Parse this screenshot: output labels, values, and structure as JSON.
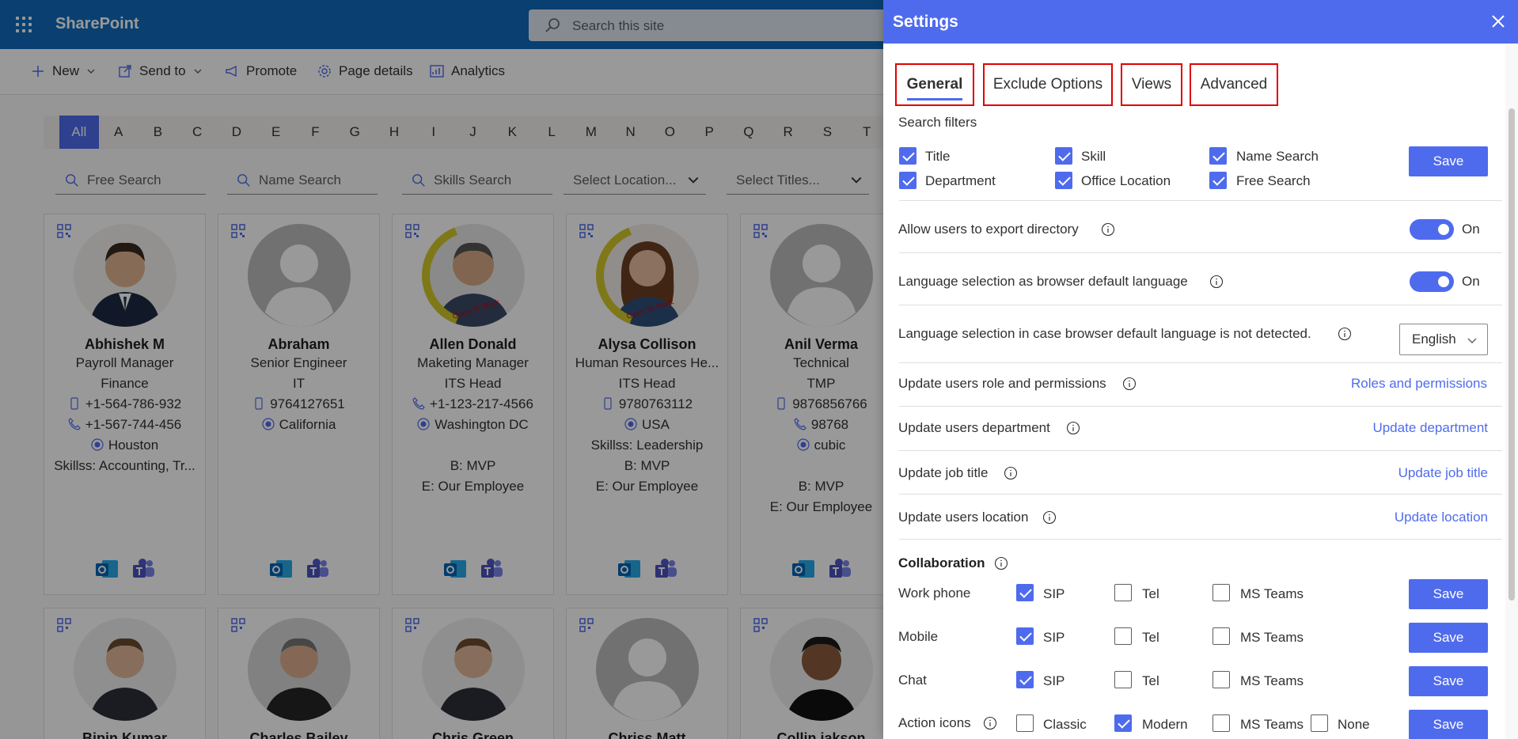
{
  "sharepoint": {
    "app_title": "SharePoint",
    "search_placeholder": "Search this site",
    "commands": [
      "New",
      "Send to",
      "Promote",
      "Page details",
      "Analytics"
    ]
  },
  "alphabet": [
    "All",
    "A",
    "B",
    "C",
    "D",
    "E",
    "F",
    "G",
    "H",
    "I",
    "J",
    "K",
    "L",
    "M",
    "N",
    "O",
    "P",
    "Q",
    "R",
    "S",
    "T"
  ],
  "filters": {
    "free_search": "Free Search",
    "name_search": "Name Search",
    "skills_search": "Skills Search",
    "location": "Select Location...",
    "titles": "Select Titles..."
  },
  "cards": [
    {
      "name": "Abhishek M",
      "lines": [
        "Payroll Manager",
        "Finance",
        "+1-564-786-932",
        "+1-567-744-456",
        "Houston",
        "Skillss: Accounting, Tr..."
      ]
    },
    {
      "name": "Abraham",
      "lines": [
        "Senior Engineer",
        "IT",
        "9764127651",
        "California"
      ]
    },
    {
      "name": "Allen Donald",
      "lines": [
        "Maketing Manager",
        "ITS Head",
        "+1-123-217-4566",
        "Washington DC",
        "",
        "B: MVP",
        "E: Our Employee"
      ],
      "badge": "Open To Work"
    },
    {
      "name": "Alysa Collison",
      "lines": [
        "Human Resources He...",
        "ITS Head",
        "9780763112",
        "USA",
        "Skillss: Leadership",
        "B: MVP",
        "E: Our Employee"
      ],
      "badge": "Open To Work"
    },
    {
      "name": "Anil Verma",
      "lines": [
        "Technical",
        "TMP",
        "9876856766",
        "98768",
        "cubic",
        "",
        "B: MVP",
        "E: Our Employee"
      ]
    }
  ],
  "row2_names": [
    "Bipin Kumar",
    "Charles Bailey",
    "Chris Green",
    "Chriss Matt",
    "Collin jakson"
  ],
  "settings": {
    "title": "Settings",
    "tabs": [
      "General",
      "Exclude Options",
      "Views",
      "Advanced"
    ],
    "search_filters_label": "Search filters",
    "search_filters": [
      {
        "label": "Title",
        "checked": true
      },
      {
        "label": "Skill",
        "checked": true
      },
      {
        "label": "Name Search",
        "checked": true
      },
      {
        "label": "Department",
        "checked": true
      },
      {
        "label": "Office Location",
        "checked": true
      },
      {
        "label": "Free Search",
        "checked": true
      }
    ],
    "save": "Save",
    "export_label": "Allow users to export directory",
    "export_state": "On",
    "browser_lang_label": "Language selection as browser default language",
    "browser_lang_state": "On",
    "fallback_lang_label": "Language selection in case browser default language is not detected.",
    "fallback_lang_value": "English",
    "roles_label": "Update users role and permissions",
    "roles_link": "Roles and permissions",
    "dept_label": "Update users department",
    "dept_link": "Update department",
    "job_label": "Update job title",
    "job_link": "Update job title",
    "loc_label": "Update users location",
    "loc_link": "Update location",
    "collab_label": "Collaboration",
    "collab_rows": [
      {
        "label": "Work phone",
        "opts": [
          {
            "label": "SIP",
            "checked": true
          },
          {
            "label": "Tel",
            "checked": false
          },
          {
            "label": "MS Teams",
            "checked": false
          }
        ]
      },
      {
        "label": "Mobile",
        "opts": [
          {
            "label": "SIP",
            "checked": true
          },
          {
            "label": "Tel",
            "checked": false
          },
          {
            "label": "MS Teams",
            "checked": false
          }
        ]
      },
      {
        "label": "Chat",
        "opts": [
          {
            "label": "SIP",
            "checked": true
          },
          {
            "label": "Tel",
            "checked": false
          },
          {
            "label": "MS Teams",
            "checked": false
          }
        ]
      }
    ],
    "action_icons_label": "Action icons",
    "action_icons": [
      {
        "label": "Classic",
        "checked": false
      },
      {
        "label": "Modern",
        "checked": true
      },
      {
        "label": "MS Teams",
        "checked": false
      },
      {
        "label": "None",
        "checked": false
      }
    ]
  }
}
